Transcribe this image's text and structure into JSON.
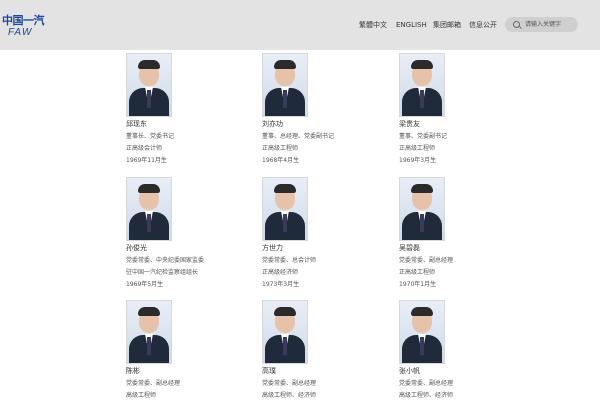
{
  "header": {
    "logo_cn": "中国一汽",
    "logo_en": "FAW",
    "nav": [
      "繁體中文",
      "ENGLISH",
      "集团邮箱",
      "信息公开"
    ],
    "search_placeholder": "请输入关键字"
  },
  "people": [
    {
      "name": "邱现东",
      "lines": [
        "董事长、党委书记",
        "正高级会计师",
        "1969年11月生"
      ]
    },
    {
      "name": "刘亦功",
      "lines": [
        "董事、总经理、党委副书记",
        "正高级工程师",
        "1968年4月生"
      ]
    },
    {
      "name": "梁贵友",
      "lines": [
        "董事、党委副书记",
        "正高级工程师",
        "1969年3月生"
      ]
    },
    {
      "name": "孙俊光",
      "lines": [
        "党委常委、中央纪委国家监委",
        "驻中国一汽纪检监察组组长",
        "1969年5月生"
      ]
    },
    {
      "name": "方世力",
      "lines": [
        "党委常委、总会计师",
        "正高级经济师",
        "1973年3月生"
      ]
    },
    {
      "name": "吴碧磊",
      "lines": [
        "党委常委、副总经理",
        "正高级工程师",
        "1970年1月生"
      ]
    },
    {
      "name": "陈彬",
      "lines": [
        "党委常委、副总经理",
        "高级工程师"
      ]
    },
    {
      "name": "高璞",
      "lines": [
        "党委常委、副总经理",
        "高级工程师、经济师"
      ]
    },
    {
      "name": "张小帆",
      "lines": [
        "党委常委、副总经理",
        "高级工程师、经济师"
      ]
    }
  ]
}
